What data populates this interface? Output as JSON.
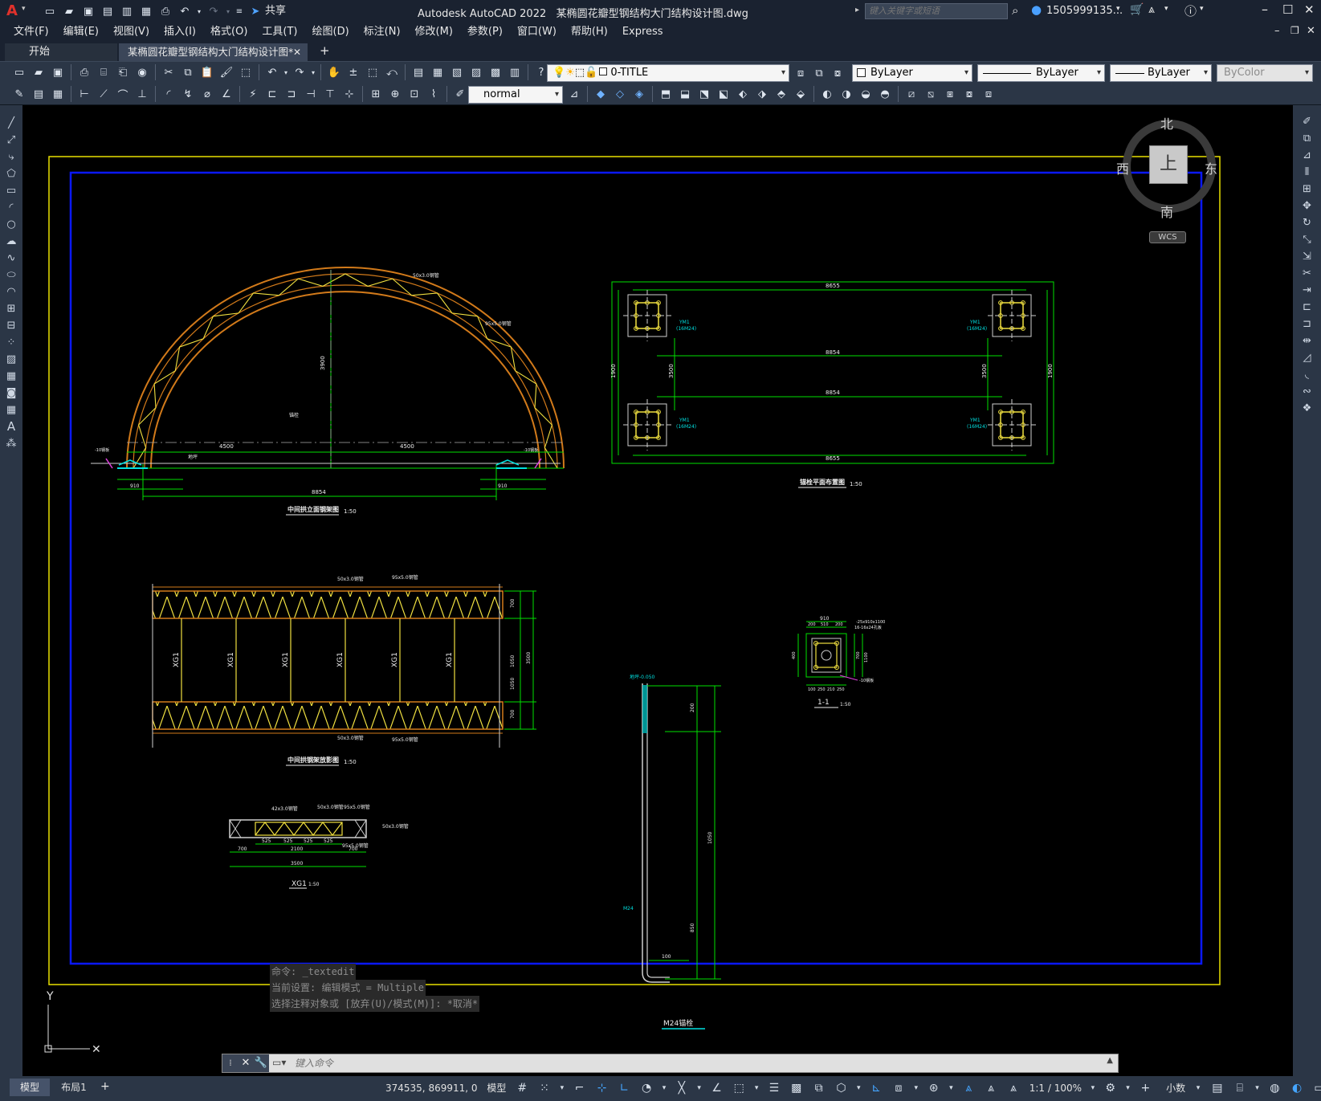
{
  "app": {
    "title": "Autodesk AutoCAD 2022",
    "file_title": "某椭圆花瓣型钢结构大门结构设计图.dwg",
    "share": "共享",
    "search_placeholder": "键入关键字或短语",
    "user": "1505999135...",
    "logo": "A"
  },
  "menu": [
    "文件(F)",
    "编辑(E)",
    "视图(V)",
    "插入(I)",
    "格式(O)",
    "工具(T)",
    "绘图(D)",
    "标注(N)",
    "修改(M)",
    "参数(P)",
    "窗口(W)",
    "帮助(H)",
    "Express"
  ],
  "tabs": {
    "start": "开始",
    "doc": "某椭圆花瓣型钢结构大门结构设计图*",
    "close": "✕",
    "add": "+"
  },
  "toolbar": {
    "layer": "0-TITLE",
    "color": "ByLayer",
    "linetype": "ByLayer",
    "lineweight": "ByLayer",
    "plotstyle": "ByColor",
    "dimstyle": "normal"
  },
  "viewcube": {
    "north": "北",
    "south": "南",
    "west": "西",
    "east": "东",
    "face": "上",
    "wcs": "WCS"
  },
  "drawing": {
    "arch_title": "中间拱立面钢架图",
    "arch_scale": "1:50",
    "plan_title": "锚栓平面布置图",
    "plan_scale": "1:50",
    "truss_title": "中间拱钢架放影图",
    "truss_scale": "1:50",
    "xg_title": "XG1",
    "xg_scale": "1:50",
    "bolt_title": "M24锚栓",
    "section_title": "1-1",
    "section_scale": "1:50",
    "xg_label": "XG1",
    "dims": {
      "d4500": "4500",
      "d3900": "3900",
      "d8854": "8854",
      "d8655": "8655",
      "d3500": "3500",
      "d1900": "1900",
      "d910": "910",
      "d510": "510",
      "d200": "200",
      "d250": "250",
      "d700": "700",
      "d1050": "1050",
      "d2100": "2100",
      "d525": "525",
      "d850": "850",
      "d100": "100",
      "d400": "400",
      "d600": "600",
      "d210": "210"
    },
    "notes": {
      "pipe50": "50x3.0钢管",
      "pipe95": "95x5.0钢管",
      "pipe42": "42x3.0钢管",
      "m24": "M24",
      "anchor": "锚栓",
      "plate": "-10钢板",
      "ground": "地坪",
      "elev": "地坪-0.050",
      "ym": "YM1",
      "ym_spec": "(16M24)",
      "base_plate": "-25x910x1100",
      "base_bolts": "16-16x24孔板"
    }
  },
  "command": {
    "line1": "命令: _textedit",
    "line2": "当前设置: 编辑模式 = Multiple",
    "line3": "选择注释对象或 [放弃(U)/模式(M)]: *取消*",
    "placeholder": "键入命令"
  },
  "layout_tabs": {
    "model": "模型",
    "layout1": "布局1",
    "add": "+"
  },
  "status": {
    "coords": "374535, 869911, 0",
    "model": "模型",
    "scale": "1:1 / 100%",
    "units": "小数"
  },
  "colors": {
    "canvas": "#000000",
    "yellow_border": "#e8e000",
    "blue_border": "#0a18ff",
    "green_dim": "#00e000",
    "orange": "#d27a1a",
    "yellow": "#f0e040",
    "cyan": "#00e0e0"
  }
}
